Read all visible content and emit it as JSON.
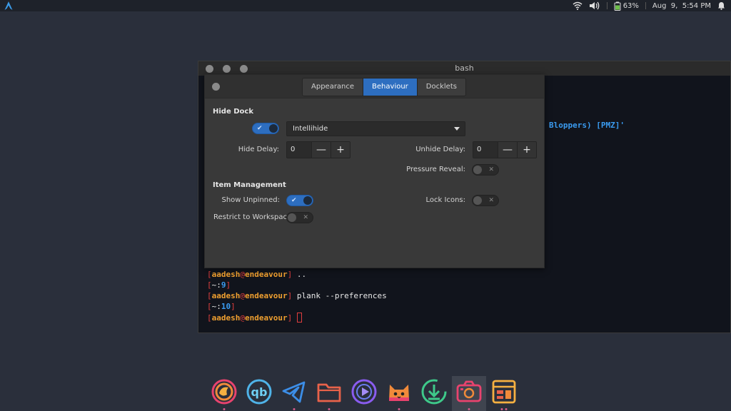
{
  "panel": {
    "battery": "63%",
    "clock": "Aug  9,  5:54 PM",
    "icons": [
      "arch-launcher-icon",
      "wifi-icon",
      "volume-icon",
      "battery-icon",
      "bell-icon"
    ]
  },
  "terminal": {
    "title": "bash",
    "partial_output": "Bloppers) [PMZ]'",
    "lines": [
      {
        "type": "prompt",
        "user": "aadesh",
        "at": "@",
        "host": "endeavour",
        "command": " .."
      },
      {
        "type": "status",
        "num": "9"
      },
      {
        "type": "prompt",
        "user": "aadesh",
        "at": "@",
        "host": "endeavour",
        "command": " plank --preferences"
      },
      {
        "type": "status",
        "num": "10"
      },
      {
        "type": "prompt",
        "user": "aadesh",
        "at": "@",
        "host": "endeavour",
        "command": ""
      }
    ]
  },
  "prefs": {
    "tabs": [
      {
        "label": "Appearance",
        "active": false
      },
      {
        "label": "Behaviour",
        "active": true
      },
      {
        "label": "Docklets",
        "active": false
      }
    ],
    "hide_dock": {
      "title": "Hide Dock",
      "enabled": true,
      "mode": "Intellihide",
      "hide_delay_label": "Hide Delay:",
      "hide_delay": "0",
      "unhide_delay_label": "Unhide Delay:",
      "unhide_delay": "0",
      "pressure_reveal_label": "Pressure Reveal:",
      "pressure_reveal": false
    },
    "item_management": {
      "title": "Item Management",
      "show_unpinned_label": "Show Unpinned:",
      "show_unpinned": true,
      "lock_icons_label": "Lock Icons:",
      "lock_icons": false,
      "restrict_label": "Restrict to Workspace:",
      "restrict": false
    },
    "minus": "—",
    "plus": "+"
  },
  "dock": {
    "items": [
      {
        "name": "firefox-icon",
        "active": false,
        "dots": 1
      },
      {
        "name": "qbittorrent-icon",
        "active": false,
        "dots": 0
      },
      {
        "name": "telegram-icon",
        "active": false,
        "dots": 1
      },
      {
        "name": "files-icon",
        "active": false,
        "dots": 1
      },
      {
        "name": "media-player-icon",
        "active": false,
        "dots": 0
      },
      {
        "name": "cat-app-icon",
        "active": false,
        "dots": 1
      },
      {
        "name": "downloader-icon",
        "active": false,
        "dots": 0
      },
      {
        "name": "screenshot-icon",
        "active": true,
        "dots": 1
      },
      {
        "name": "plank-preferences-icon",
        "active": false,
        "dots": 2
      }
    ]
  }
}
